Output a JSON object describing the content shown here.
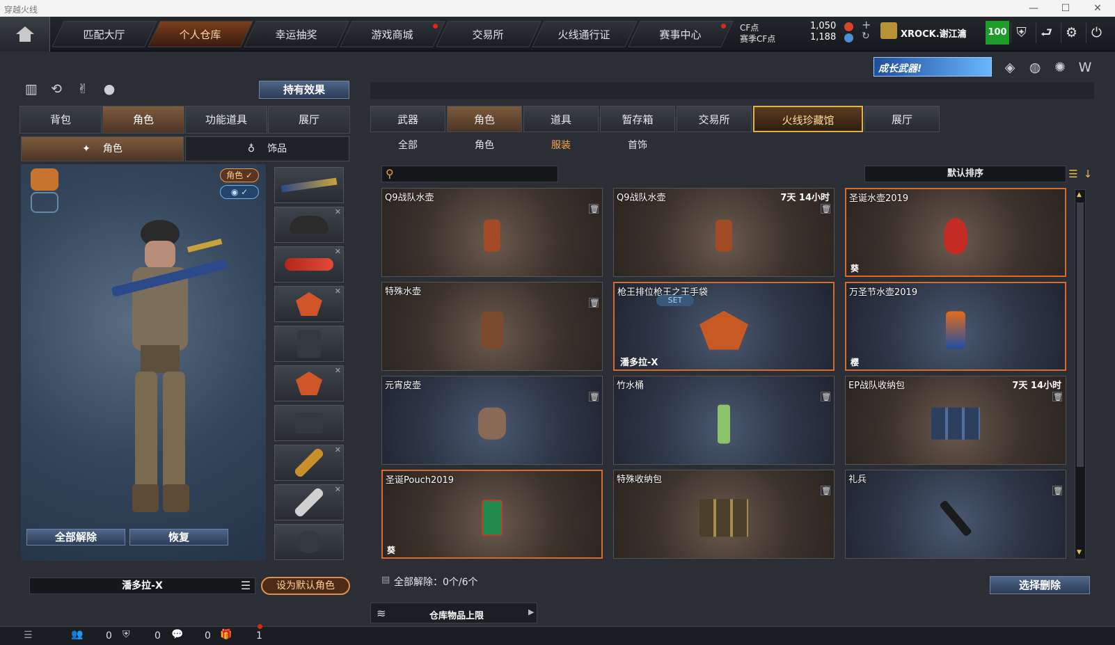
{
  "window": {
    "title": "穿越火线",
    "minimize": "—",
    "maximize": "☐",
    "close": "✕"
  },
  "nav": {
    "items": [
      {
        "label": "匹配大厅"
      },
      {
        "label": "个人仓库"
      },
      {
        "label": "幸运抽奖"
      },
      {
        "label": "游戏商城"
      },
      {
        "label": "交易所"
      },
      {
        "label": "火线通行证"
      },
      {
        "label": "赛事中心"
      }
    ]
  },
  "currency": {
    "cf_label": "CF点",
    "cf_value": "1,050",
    "match_label": "赛季CF点",
    "match_value": "1,188"
  },
  "user": {
    "name": "XROCK.谢江瀹",
    "level": "100"
  },
  "banner": {
    "text": "成长武器!"
  },
  "left": {
    "hold_effect": "持有效果",
    "tabs": [
      "背包",
      "角色",
      "功能道具",
      "展厅"
    ],
    "subtabs": [
      "角色",
      "饰品"
    ],
    "badge_role": "角色 ✓",
    "badge_eye": "◉ ✓",
    "unequip_all": "全部解除",
    "restore": "恢复",
    "character_name": "潘多拉-X",
    "set_default": "设为默认角色"
  },
  "right": {
    "tabs": [
      "武器",
      "角色",
      "道具",
      "暂存箱",
      "交易所",
      "火线珍藏馆",
      "展厅"
    ],
    "subtabs": [
      "全部",
      "角色",
      "服装",
      "首饰"
    ],
    "search_placeholder": "",
    "sort_label": "默认排序",
    "unequip_status": "全部解除：0个/6个",
    "warehouse_limit": "仓库物品上限",
    "select_delete": "选择删除"
  },
  "items": [
    {
      "name": "Q9战队水壶",
      "time": "",
      "corner": "",
      "owner": ""
    },
    {
      "name": "Q9战队水壶",
      "time": "7天 14小时",
      "corner": "",
      "owner": ""
    },
    {
      "name": "圣诞水壶2019",
      "time": "",
      "corner": "葵",
      "owner": ""
    },
    {
      "name": "特殊水壶",
      "time": "",
      "corner": "",
      "owner": ""
    },
    {
      "name": "枪王排位枪王之王手袋",
      "time": "",
      "corner": "",
      "owner": "潘多拉-X",
      "set": "SET"
    },
    {
      "name": "万圣节水壶2019",
      "time": "",
      "corner": "樱",
      "owner": ""
    },
    {
      "name": "元宵皮壶",
      "time": "",
      "corner": "",
      "owner": ""
    },
    {
      "name": "竹水桶",
      "time": "",
      "corner": "",
      "owner": ""
    },
    {
      "name": "EP战队收纳包",
      "time": "7天 14小时",
      "corner": "",
      "owner": ""
    },
    {
      "name": "圣诞Pouch2019",
      "time": "",
      "corner": "葵",
      "owner": ""
    },
    {
      "name": "特殊收纳包",
      "time": "",
      "corner": "",
      "owner": ""
    },
    {
      "name": "礼兵",
      "time": "",
      "corner": "",
      "owner": ""
    }
  ],
  "statusbar": {
    "count1": "0",
    "count2": "0",
    "count3": "0",
    "count4": "1"
  }
}
